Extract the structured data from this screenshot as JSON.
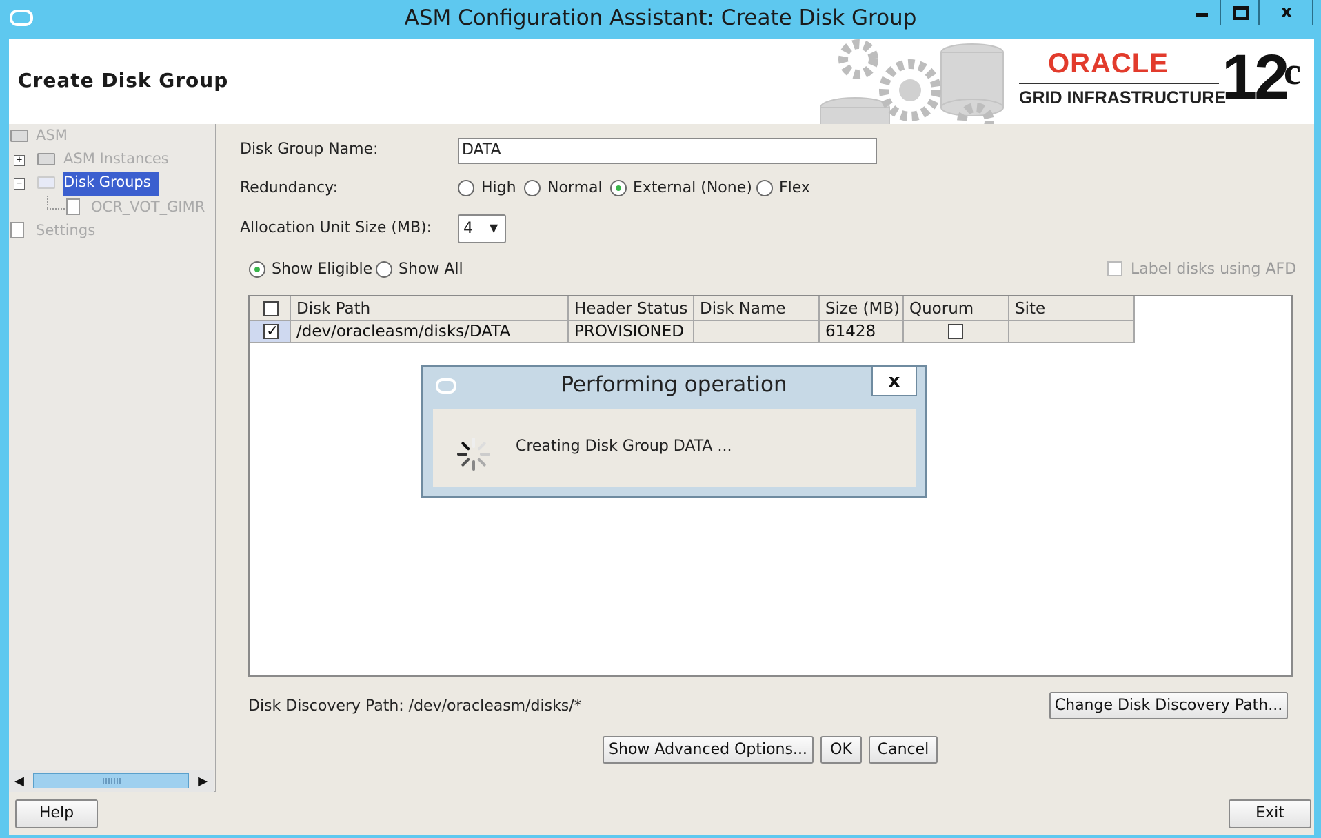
{
  "window": {
    "title": "ASM Configuration Assistant: Create Disk Group",
    "minimize": "minimize",
    "maximize": "maximize",
    "close": "x"
  },
  "header": {
    "page_title": "Create Disk Group",
    "brand": "ORACLE",
    "product": "GRID INFRASTRUCTURE",
    "version": "12",
    "version_suffix": "c"
  },
  "tree": {
    "root": "ASM",
    "asm_instances": "ASM Instances",
    "disk_groups": "Disk Groups",
    "disk_group_child": "OCR_VOT_GIMR",
    "settings": "Settings",
    "expand_symbol": "+",
    "collapse_symbol": "−"
  },
  "form": {
    "disk_group_name_label": "Disk Group Name:",
    "disk_group_name_value": "DATA",
    "redundancy_label": "Redundancy:",
    "redundancy_options": [
      "High",
      "Normal",
      "External (None)",
      "Flex"
    ],
    "redundancy_selected": "External (None)",
    "au_size_label": "Allocation Unit Size (MB):",
    "au_size_value": "4",
    "show_eligible": "Show Eligible",
    "show_all": "Show All",
    "show_selected": "Show Eligible",
    "label_afd": "Label disks using AFD"
  },
  "table": {
    "columns": [
      "Disk Path",
      "Header Status",
      "Disk Name",
      "Size (MB)",
      "Quorum",
      "Site"
    ],
    "rows": [
      {
        "checked": true,
        "disk_path": "/dev/oracleasm/disks/DATA",
        "header_status": "PROVISIONED",
        "disk_name": "",
        "size_mb": "61428",
        "quorum": false,
        "site": ""
      }
    ]
  },
  "discovery": {
    "text": "Disk Discovery Path: /dev/oracleasm/disks/*",
    "change_button": "Change Disk Discovery Path..."
  },
  "buttons": {
    "advanced": "Show Advanced Options...",
    "ok": "OK",
    "cancel": "Cancel",
    "help": "Help",
    "exit": "Exit"
  },
  "dialog": {
    "title": "Performing operation",
    "message": "Creating Disk Group DATA ...",
    "close": "x"
  },
  "icons": {
    "app": "oracle-app-icon",
    "spinner": "spinner-icon",
    "folder": "folder-icon",
    "file": "file-icon"
  },
  "colors": {
    "titlebar": "#5ec8ef",
    "selection": "#3b5fcf",
    "oracle_red": "#e23b2c",
    "radio_selected": "#39b54a"
  }
}
